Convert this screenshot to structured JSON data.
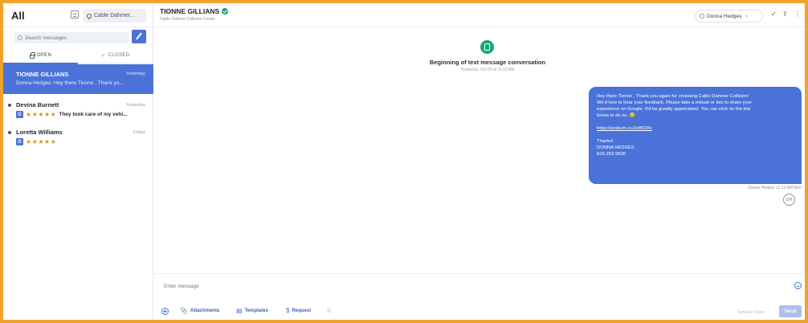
{
  "sidebar": {
    "title": "All",
    "location": "Cable Dahmer...",
    "search_placeholder": "Search messages",
    "tabs": [
      {
        "label": "OPEN"
      },
      {
        "label": "CLOSED"
      }
    ],
    "conversations": [
      {
        "name": "TIONNE GILLIANS",
        "time": "Yesterday",
        "preview": "Donna Hedges: Hey there Tionne , Thank yo...",
        "active": true
      },
      {
        "name": "Devina Burnett",
        "time": "Yesterday",
        "stars": "★★★★★",
        "review": "They took care of my vehi...",
        "badge": "G"
      },
      {
        "name": "Loretta Williams",
        "time": "Friday",
        "stars": "★★★★★",
        "badge": "G"
      }
    ]
  },
  "header": {
    "contact_name": "TIONNE GILLIANS",
    "contact_sub": "Cable Dahmer Collision Center",
    "assignee": "Donna Hedges",
    "check_glyph": "✓",
    "upload_glyph": "⇪",
    "more_glyph": "⋮"
  },
  "thread": {
    "start_title": "Beginning of text message conversation",
    "start_date": "Yesterday, Oct 05 at 11:13 AM",
    "message_lines": [
      "Hey there Tionne , Thank you again for choosing Cable Dahmer Collision!",
      "We'd love to hear your feedback. Please take a minute or two to share your",
      "experience on Google. It'd be greatly appreciated. You can click on the link",
      "below to do so. 😊"
    ],
    "link": "https://podium.co/2x8KDKr",
    "signoff": [
      "Thanks!",
      "DONNA HEDGES",
      "816-252-9600"
    ],
    "meta": "Donna Hedges 11:13 AM Mon",
    "avatar_initials": "DH"
  },
  "composer": {
    "placeholder": "Enter message",
    "tools": [
      {
        "label": "Attachments",
        "icon": "📎"
      },
      {
        "label": "Templates",
        "icon": "▤"
      },
      {
        "label": "Request",
        "icon": "$"
      }
    ],
    "star_glyph": "☆",
    "send_close": "Send & Close",
    "send": "Send"
  },
  "colors": {
    "accent": "#4b72d9",
    "green": "#14a77e",
    "frame": "#f0a32a"
  }
}
